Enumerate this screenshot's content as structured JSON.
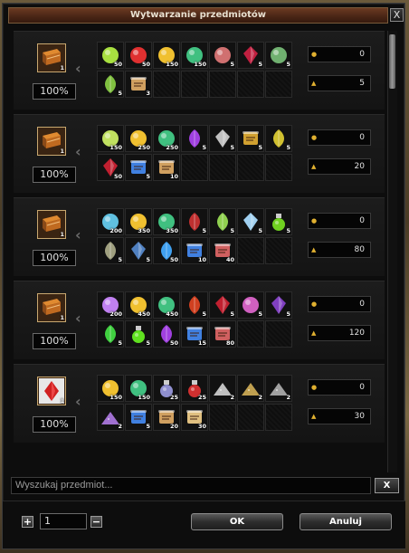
{
  "window": {
    "title": "Wytwarzanie przedmiotów",
    "close_label": "X"
  },
  "search": {
    "placeholder": "Wyszukaj przedmiot...",
    "clear_label": "X"
  },
  "footer": {
    "quantity": "1",
    "plus_label": "+",
    "minus_label": "−",
    "ok_label": "OK",
    "cancel_label": "Anuluj"
  },
  "recipes": [
    {
      "result": {
        "icon": "book-icon",
        "qty": "1"
      },
      "percent": "100%",
      "cost_gold": "0",
      "cost_points": "5",
      "ingredients": [
        {
          "icon": "spark-orb-icon",
          "color": "#a8e040",
          "qty": "50"
        },
        {
          "icon": "red-spark-icon",
          "color": "#e03030",
          "qty": "50"
        },
        {
          "icon": "golden-orb-icon",
          "color": "#f0c030",
          "qty": "150"
        },
        {
          "icon": "green-stone-icon",
          "color": "#40c080",
          "qty": "150"
        },
        {
          "icon": "pink-stone-icon",
          "color": "#d07070",
          "qty": "5"
        },
        {
          "icon": "red-crystal-icon",
          "color": "#c02040",
          "qty": "5"
        },
        {
          "icon": "green-pearl-icon",
          "color": "#70b070",
          "qty": "5"
        },
        {
          "icon": "green-swirl-icon",
          "color": "#80c040",
          "qty": "5"
        },
        {
          "icon": "scroll-icon",
          "color": "#d0a060",
          "qty": "3"
        },
        {
          "icon": "",
          "color": "",
          "qty": ""
        },
        {
          "icon": "",
          "color": "",
          "qty": ""
        },
        {
          "icon": "",
          "color": "",
          "qty": ""
        },
        {
          "icon": "",
          "color": "",
          "qty": ""
        },
        {
          "icon": "",
          "color": "",
          "qty": ""
        }
      ]
    },
    {
      "result": {
        "icon": "book-icon",
        "qty": "1"
      },
      "percent": "100%",
      "cost_gold": "0",
      "cost_points": "20",
      "ingredients": [
        {
          "icon": "spark-orb-icon",
          "color": "#c0e060",
          "qty": "150"
        },
        {
          "icon": "golden-orb-icon",
          "color": "#f0c030",
          "qty": "250"
        },
        {
          "icon": "green-stone-icon",
          "color": "#40c080",
          "qty": "250"
        },
        {
          "icon": "purple-flame-icon",
          "color": "#a040e0",
          "qty": "5"
        },
        {
          "icon": "silver-feather-icon",
          "color": "#c0c0c0",
          "qty": "5"
        },
        {
          "icon": "gold-scroll-icon",
          "color": "#d0a030",
          "qty": "5"
        },
        {
          "icon": "yellow-leaf-icon",
          "color": "#d0c030",
          "qty": "5"
        },
        {
          "icon": "red-crystal-icon",
          "color": "#c02030",
          "qty": "50"
        },
        {
          "icon": "blue-scroll-icon",
          "color": "#4080e0",
          "qty": "5"
        },
        {
          "icon": "scroll-icon",
          "color": "#d0a060",
          "qty": "10"
        },
        {
          "icon": "",
          "color": "",
          "qty": ""
        },
        {
          "icon": "",
          "color": "",
          "qty": ""
        },
        {
          "icon": "",
          "color": "",
          "qty": ""
        },
        {
          "icon": "",
          "color": "",
          "qty": ""
        }
      ]
    },
    {
      "result": {
        "icon": "book-icon",
        "qty": "1"
      },
      "percent": "100%",
      "cost_gold": "0",
      "cost_points": "80",
      "ingredients": [
        {
          "icon": "spark-orb-icon",
          "color": "#60c0e0",
          "qty": "200"
        },
        {
          "icon": "golden-orb-icon",
          "color": "#f0c030",
          "qty": "350"
        },
        {
          "icon": "green-stone-icon",
          "color": "#40c080",
          "qty": "350"
        },
        {
          "icon": "red-flower-icon",
          "color": "#c03030",
          "qty": "5"
        },
        {
          "icon": "green-leaf-icon",
          "color": "#90d050",
          "qty": "5"
        },
        {
          "icon": "ice-crystal-icon",
          "color": "#a0d0f0",
          "qty": "5"
        },
        {
          "icon": "green-cauldron-icon",
          "color": "#70d020",
          "qty": "5"
        },
        {
          "icon": "compass-icon",
          "color": "#a0a080",
          "qty": "5"
        },
        {
          "icon": "blue-gem-icon",
          "color": "#5080c0",
          "qty": "5"
        },
        {
          "icon": "blue-flame-icon",
          "color": "#40a0f0",
          "qty": "50"
        },
        {
          "icon": "blue-scroll-icon",
          "color": "#4080e0",
          "qty": "10"
        },
        {
          "icon": "red-scroll-icon",
          "color": "#d06060",
          "qty": "40"
        },
        {
          "icon": "",
          "color": "",
          "qty": ""
        },
        {
          "icon": "",
          "color": "",
          "qty": ""
        }
      ]
    },
    {
      "result": {
        "icon": "book-icon",
        "qty": "1"
      },
      "percent": "100%",
      "cost_gold": "0",
      "cost_points": "120",
      "ingredients": [
        {
          "icon": "spark-orb-icon",
          "color": "#c080f0",
          "qty": "200"
        },
        {
          "icon": "golden-orb-icon",
          "color": "#f0c030",
          "qty": "450"
        },
        {
          "icon": "green-stone-icon",
          "color": "#40c080",
          "qty": "450"
        },
        {
          "icon": "red-flower-icon",
          "color": "#d04020",
          "qty": "5"
        },
        {
          "icon": "red-crystal-icon",
          "color": "#c02030",
          "qty": "5"
        },
        {
          "icon": "pink-stone-icon",
          "color": "#d060c0",
          "qty": "5"
        },
        {
          "icon": "purple-crystal-icon",
          "color": "#8040c0",
          "qty": "5"
        },
        {
          "icon": "green-bolt-icon",
          "color": "#40d040",
          "qty": "5"
        },
        {
          "icon": "green-vial-icon",
          "color": "#60e020",
          "qty": "5"
        },
        {
          "icon": "purple-flame-icon",
          "color": "#a040e0",
          "qty": "50"
        },
        {
          "icon": "blue-scroll-icon",
          "color": "#4080e0",
          "qty": "15"
        },
        {
          "icon": "red-scroll-icon",
          "color": "#d06060",
          "qty": "80"
        },
        {
          "icon": "",
          "color": "",
          "qty": ""
        },
        {
          "icon": "",
          "color": "",
          "qty": ""
        }
      ]
    },
    {
      "result": {
        "icon": "red-gem-icon",
        "qty": "1"
      },
      "percent": "100%",
      "cost_gold": "0",
      "cost_points": "30",
      "ingredients": [
        {
          "icon": "golden-orb-icon",
          "color": "#f0c030",
          "qty": "150"
        },
        {
          "icon": "green-stone-icon",
          "color": "#40c080",
          "qty": "150"
        },
        {
          "icon": "potion-icon",
          "color": "#9090d0",
          "qty": "25"
        },
        {
          "icon": "red-potion-icon",
          "color": "#d03030",
          "qty": "25"
        },
        {
          "icon": "silver-dust-icon",
          "color": "#c0c0c0",
          "qty": "2"
        },
        {
          "icon": "gold-dust-icon",
          "color": "#c0a050",
          "qty": "2"
        },
        {
          "icon": "grey-dust-icon",
          "color": "#a0a0a0",
          "qty": "2"
        },
        {
          "icon": "purple-dust-icon",
          "color": "#a070d0",
          "qty": "2"
        },
        {
          "icon": "blue-scroll-icon",
          "color": "#4080e0",
          "qty": "5"
        },
        {
          "icon": "scroll-icon",
          "color": "#d0a060",
          "qty": "20"
        },
        {
          "icon": "parchment-icon",
          "color": "#e0c080",
          "qty": "30"
        },
        {
          "icon": "",
          "color": "",
          "qty": ""
        },
        {
          "icon": "",
          "color": "",
          "qty": ""
        },
        {
          "icon": "",
          "color": "",
          "qty": ""
        }
      ]
    }
  ]
}
